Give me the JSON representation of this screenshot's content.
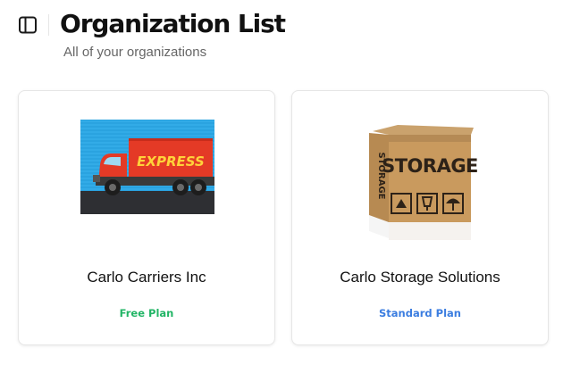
{
  "header": {
    "title": "Organization List",
    "subtitle": "All of your organizations",
    "toggle_icon": "sidebar-toggle-icon"
  },
  "organizations": [
    {
      "name": "Carlo Carriers Inc",
      "plan": "Free Plan",
      "plan_color": "#22b566",
      "image": {
        "icon": "express-truck-image",
        "text": "EXPRESS"
      }
    },
    {
      "name": "Carlo Storage Solutions",
      "plan": "Standard Plan",
      "plan_color": "#3b7de0",
      "image": {
        "icon": "storage-box-image",
        "text": "STORAGE",
        "side_text": "STORAGE"
      }
    }
  ],
  "colors": {
    "title": "#111111",
    "subtitle": "#666666",
    "card_border": "#e6e6e6"
  }
}
